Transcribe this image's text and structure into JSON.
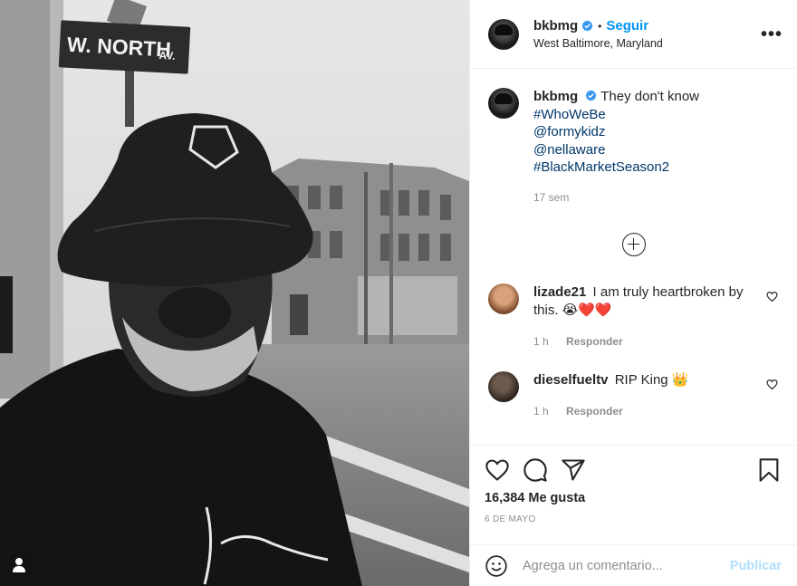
{
  "photo": {
    "sign_text": "W. NORTH",
    "sign_suffix": "AV."
  },
  "header": {
    "username": "bkbmg",
    "separator": "•",
    "follow_label": "Seguir",
    "location": "West Baltimore, Maryland",
    "more_label": "•••"
  },
  "caption": {
    "username": "bkbmg",
    "text": "They don't know",
    "tags": [
      "#WhoWeBe",
      "@formykidz",
      "@nellaware",
      "#BlackMarketSeason2"
    ],
    "time": "17 sem"
  },
  "comments": [
    {
      "username": "lizade21",
      "text": "I am truly heartbroken by this. 😭❤️❤️",
      "time": "1 h",
      "reply_label": "Responder"
    },
    {
      "username": "dieselfueltv",
      "text": "RIP King 👑",
      "time": "1 h",
      "reply_label": "Responder"
    }
  ],
  "actions": {
    "likes": "16,384 Me gusta",
    "date": "6 DE MAYO"
  },
  "add_comment": {
    "placeholder": "Agrega un comentario...",
    "publish_label": "Publicar"
  },
  "colors": {
    "link": "#00376b",
    "follow": "#0095f6",
    "publish_disabled": "#b2dffc",
    "verified": "#3897f0"
  }
}
